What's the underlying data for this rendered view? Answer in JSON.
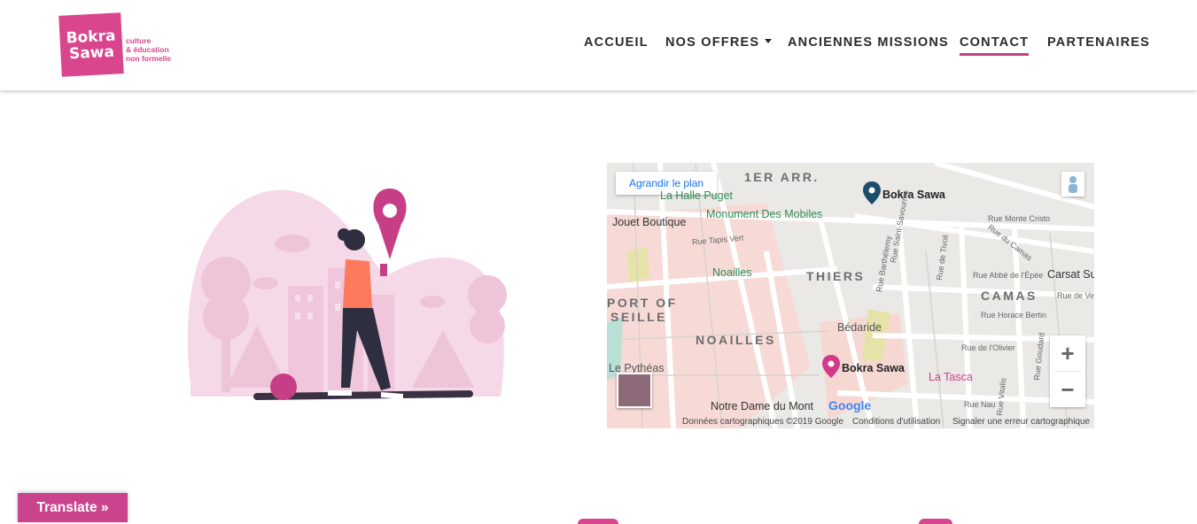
{
  "header": {
    "logo": {
      "line1": "Bokra",
      "line2": "Sawa",
      "tagline": [
        "culture",
        "& éducation",
        "non formelle"
      ]
    },
    "nav": [
      {
        "label": "ACCUEIL"
      },
      {
        "label": "NOS OFFRES"
      },
      {
        "label": "ANCIENNES MISSIONS"
      },
      {
        "label": "CONTACT"
      },
      {
        "label": "PARTENAIRES"
      }
    ],
    "active_nav": "CONTACT"
  },
  "map": {
    "enlarge_label": "Agrandir le plan",
    "zoom_in": "+",
    "zoom_out": "−",
    "districts": [
      "1ER ARR.",
      "THIERS",
      "CAMAS",
      "NOAILLES",
      "PORT OF",
      "SEILLE"
    ],
    "places": [
      {
        "name": "Bokra Sawa",
        "kind": "marker-dark"
      },
      {
        "name": "Bokra Sawa",
        "kind": "marker-pink"
      },
      {
        "name": "La Halle Puget",
        "kind": "green"
      },
      {
        "name": "Monument Des Mobiles",
        "kind": "green"
      },
      {
        "name": "Jouet Boutique",
        "kind": "dark"
      },
      {
        "name": "Noailles",
        "kind": "green"
      },
      {
        "name": "Bédaride",
        "kind": "gray"
      },
      {
        "name": "La Tasca",
        "kind": "pink"
      },
      {
        "name": "Carsat Su",
        "kind": "dark"
      },
      {
        "name": "Notre Dame du Mont",
        "kind": "dark"
      },
      {
        "name": "Le Pythéas",
        "kind": "gray"
      }
    ],
    "streets": [
      "Rue Tapis Vert",
      "Rue Monte Cristo",
      "Rue du Camas",
      "Rue Abbé de l'Épée",
      "Rue Horace Bertin",
      "Rue de l'Olivier",
      "Rue Nau",
      "Rue Saint-Savournin",
      "Rue Barthélemy",
      "Rue de Tivoli",
      "Rue Goudard",
      "Rue Vitalis",
      "Rue de Ve"
    ],
    "attribution": "Données cartographiques ©2019 Google",
    "terms": "Conditions d'utilisation",
    "report": "Signaler une erreur cartographique",
    "brand": "Google"
  },
  "translate_label": "Translate »",
  "colors": {
    "brand_pink": "#d9468e",
    "nav_underline": "#c63e85",
    "translate_bg": "#c9448c"
  }
}
